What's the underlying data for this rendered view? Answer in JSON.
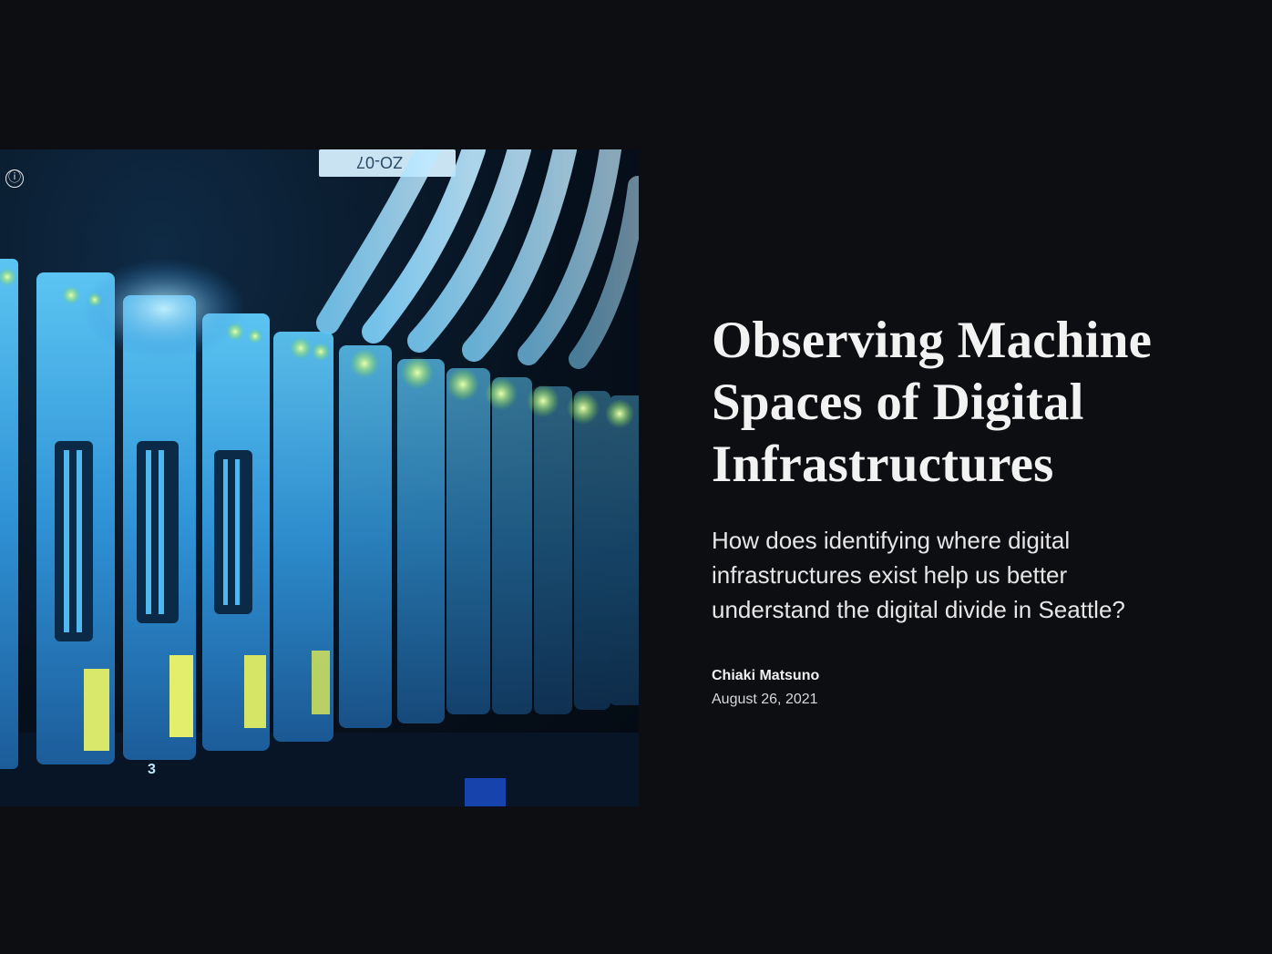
{
  "hero": {
    "image_alt": "Server rack with network cables and glowing drive indicators",
    "info_icon_glyph": "ⓘ",
    "tag_text": "ZO-07",
    "drive_numbers": [
      "3"
    ],
    "accent_colors": {
      "blue": "#3fa9e6",
      "led_green": "#9cff4a"
    }
  },
  "article": {
    "title": "Observing Machine Spaces of Digital Infrastructures",
    "subtitle": "How does identifying where digital infrastructures exist help us better understand the digital divide in Seattle?",
    "author": "Chiaki Matsuno",
    "date": "August 26, 2021"
  },
  "colors": {
    "background": "#0d0e12",
    "text": "#f2f2f2"
  }
}
